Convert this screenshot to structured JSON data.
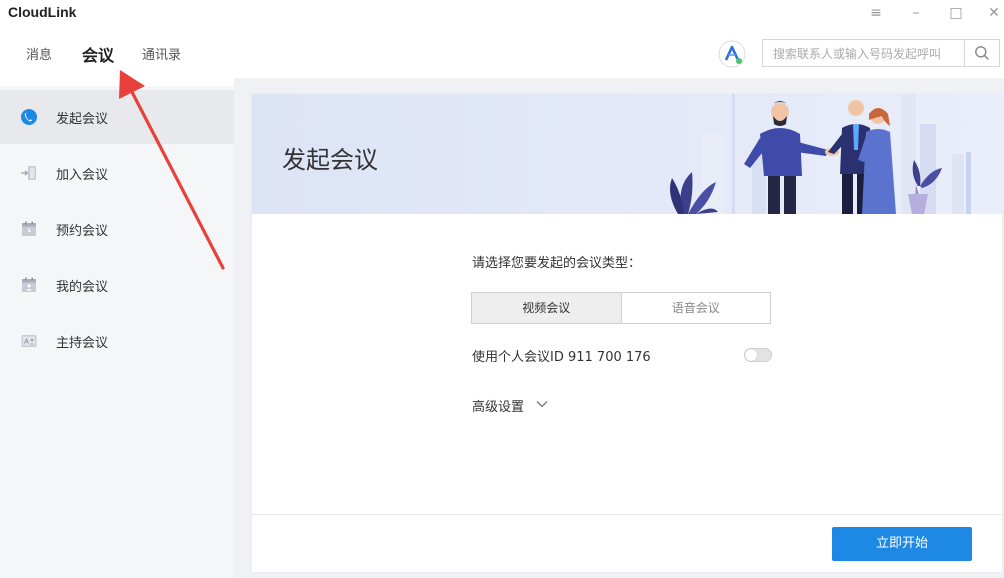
{
  "window": {
    "title": "CloudLink",
    "controls": [
      {
        "name": "menu-button",
        "icon": "hamburger-icon",
        "glyph": "≡"
      },
      {
        "name": "minimize-button",
        "icon": "minimize-icon",
        "glyph": "–"
      },
      {
        "name": "maximize-button",
        "icon": "maximize-icon",
        "glyph": "□"
      },
      {
        "name": "close-button",
        "icon": "close-icon",
        "glyph": "✕"
      }
    ]
  },
  "nav": {
    "tabs": [
      {
        "label": "消息"
      },
      {
        "label": "会议"
      },
      {
        "label": "通讯录"
      }
    ],
    "active_index": 1
  },
  "search": {
    "placeholder": "搜索联系人或输入号码发起呼叫",
    "value": ""
  },
  "sidebar": {
    "items": [
      {
        "label": "发起会议",
        "icon": "phone-badge-icon"
      },
      {
        "label": "加入会议",
        "icon": "join-door-icon"
      },
      {
        "label": "预约会议",
        "icon": "calendar-icon"
      },
      {
        "label": "我的会议",
        "icon": "calendar-user-icon"
      },
      {
        "label": "主持会议",
        "icon": "host-screen-icon"
      }
    ],
    "active_index": 0
  },
  "main": {
    "banner_title": "发起会议",
    "prompt": "请选择您要发起的会议类型：",
    "meeting_types": [
      {
        "label": "视频会议"
      },
      {
        "label": "语音会议"
      }
    ],
    "selected_type_index": 0,
    "personal_id_label": "使用个人会议ID 911 700 176",
    "personal_id_enabled": false,
    "advanced_label": "高级设置",
    "start_label": "立即开始"
  },
  "colors": {
    "accent": "#1e88e5",
    "sidebar_bg": "#f5f6f8",
    "sidebar_active": "#e8e9ed",
    "banner_bg": "#dde4f6",
    "annotation_arrow": "#e8403a"
  }
}
